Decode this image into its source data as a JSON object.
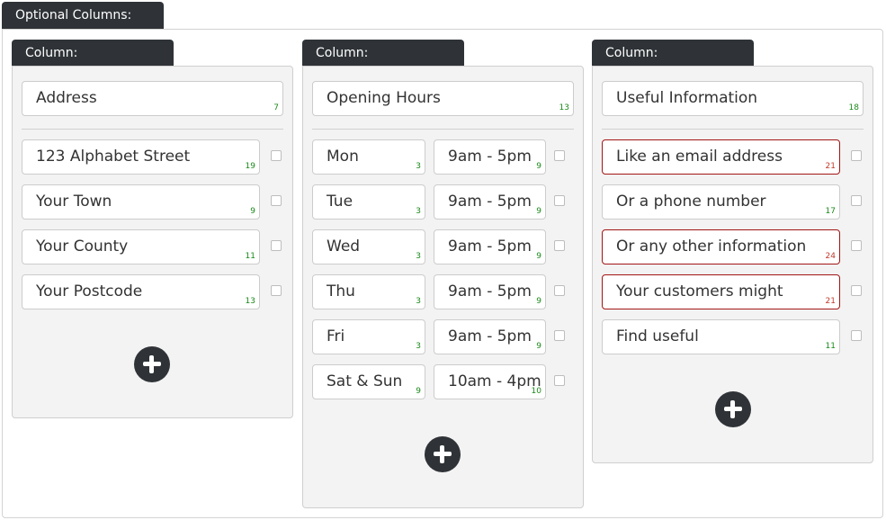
{
  "optional_columns": {
    "label": "Optional Columns:"
  },
  "column_label": "Column:",
  "columns": [
    {
      "title": {
        "value": "Address",
        "count": "7"
      },
      "rows": [
        {
          "value": "123 Alphabet Street",
          "count": "19"
        },
        {
          "value": "Your Town",
          "count": "9"
        },
        {
          "value": "Your County",
          "count": "11"
        },
        {
          "value": "Your Postcode",
          "count": "13"
        }
      ]
    },
    {
      "title": {
        "value": "Opening Hours",
        "count": "13"
      },
      "rows": [
        {
          "day": "Mon",
          "day_count": "3",
          "hours": "9am - 5pm",
          "hours_count": "9"
        },
        {
          "day": "Tue",
          "day_count": "3",
          "hours": "9am - 5pm",
          "hours_count": "9"
        },
        {
          "day": "Wed",
          "day_count": "3",
          "hours": "9am - 5pm",
          "hours_count": "9"
        },
        {
          "day": "Thu",
          "day_count": "3",
          "hours": "9am - 5pm",
          "hours_count": "9"
        },
        {
          "day": "Fri",
          "day_count": "3",
          "hours": "9am - 5pm",
          "hours_count": "9"
        },
        {
          "day": "Sat & Sun",
          "day_count": "9",
          "hours": "10am - 4pm",
          "hours_count": "10"
        }
      ]
    },
    {
      "title": {
        "value": "Useful Information",
        "count": "18"
      },
      "rows": [
        {
          "value": "Like an email address",
          "count": "21",
          "error": true
        },
        {
          "value": "Or a phone number",
          "count": "17",
          "error": false
        },
        {
          "value": "Or any other information",
          "count": "24",
          "error": true
        },
        {
          "value": "Your customers might",
          "count": "21",
          "error": true
        },
        {
          "value": "Find useful",
          "count": "11",
          "error": false
        }
      ]
    }
  ],
  "icons": {
    "add": "plus-circle-icon",
    "checkbox": "checkbox-icon"
  },
  "colors": {
    "tab_bg": "#2f3337",
    "count_ok": "#1a8a1a",
    "count_error": "#c0392b",
    "error_border": "#a31515"
  }
}
